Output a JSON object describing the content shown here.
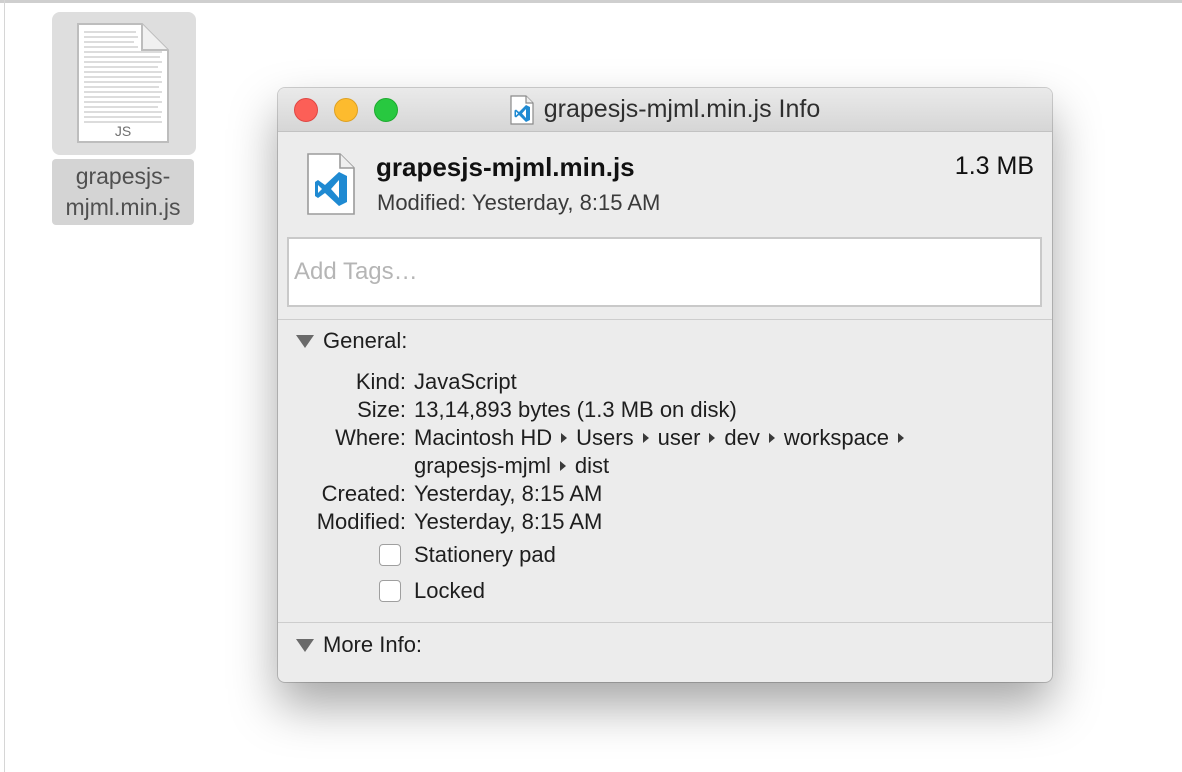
{
  "desktop_file": {
    "icon_badge": "JS",
    "label_line1": "grapesjs-",
    "label_line2": "mjml.min.js"
  },
  "window": {
    "title": "grapesjs-mjml.min.js Info",
    "file_name": "grapesjs-mjml.min.js",
    "file_size": "1.3 MB",
    "modified_summary": "Modified: Yesterday, 8:15 AM",
    "tags_placeholder": "Add Tags…"
  },
  "general": {
    "heading": "General:",
    "kind_label": "Kind:",
    "kind_value": "JavaScript",
    "size_label": "Size:",
    "size_value": "13,14,893 bytes (1.3 MB on disk)",
    "where_label": "Where:",
    "where_path_line1": [
      "Macintosh HD",
      "Users",
      "user",
      "dev",
      "workspace"
    ],
    "where_path_line2": [
      "grapesjs-mjml",
      "dist"
    ],
    "created_label": "Created:",
    "created_value": "Yesterday, 8:15 AM",
    "modified_label": "Modified:",
    "modified_value": "Yesterday, 8:15 AM",
    "stationery_label": "Stationery pad",
    "locked_label": "Locked"
  },
  "more_info": {
    "heading": "More Info:"
  },
  "colors": {
    "close": "#fc5f57",
    "minimize": "#fdbb2e",
    "zoom": "#28c840",
    "vscode_blue": "#1f8ad2"
  },
  "icons": {
    "desktop_file": "js-document-icon",
    "title": "vscode-file-icon",
    "header": "vscode-file-icon",
    "disclosure": "disclosure-triangle-icon"
  }
}
